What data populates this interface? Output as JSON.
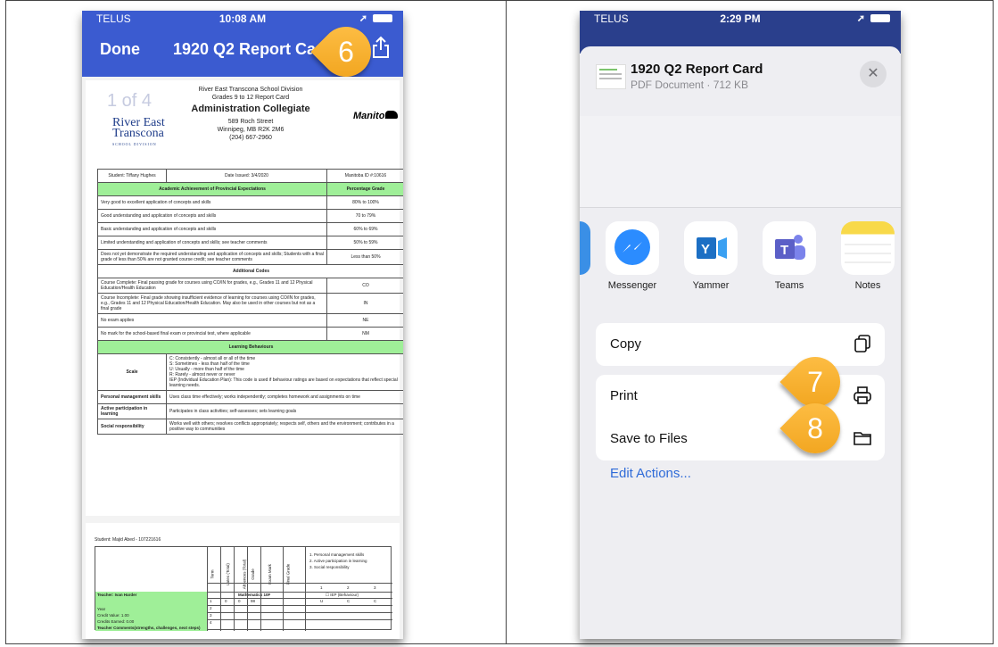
{
  "left_phone": {
    "status": {
      "carrier": "TELUS",
      "time": "10:08 AM"
    },
    "nav": {
      "done_label": "Done",
      "title": "1920 Q2 Report Card."
    },
    "step_badge": "6",
    "doc": {
      "page_count": "1 of 4",
      "header_lines": [
        "River East Transcona School Division",
        "Grades 9 to 12 Report Card"
      ],
      "school_name": "Administration Collegiate",
      "address_lines": [
        "589 Roch Street",
        "Winnipeg, MB R2K 2M6",
        "(204) 667-2960"
      ],
      "logo_left": [
        "River East",
        "Transcona"
      ],
      "logo_left_sub": "SCHOOL DIVISION",
      "logo_right": "Manitoba",
      "student_row": [
        "Student: Tiffany Hughes",
        "Date Issued: 3/4/2020",
        "Manitoba ID #:10616"
      ],
      "achievement_header": [
        "Academic Achievement of Provincial Expectations",
        "Percentage Grade"
      ],
      "achievement_rows": [
        [
          "Very good to excellent application of concepts and skills",
          "80% to 100%"
        ],
        [
          "Good understanding and application of concepts and skills",
          "70 to 79%"
        ],
        [
          "Basic understanding and application of concepts and skills",
          "60% to 69%"
        ],
        [
          "Limited understanding and application of concepts and skills; see teacher comments",
          "50% to 59%"
        ],
        [
          "Does not yet demonstrate the required understanding and application of concepts and skills; Students with a final grade of less than 50% are not granted course credit; see teacher comments",
          "Less than 50%"
        ]
      ],
      "additional_codes_title": "Additional Codes",
      "code_rows": [
        [
          "Course Complete: Final passing grade for courses using CO/IN for grades, e.g., Grades 11 and 12 Physical Education/Health Education",
          "CO"
        ],
        [
          "Course Incomplete: Final grade showing insufficient evidence of learning for courses using CO/IN for grades, e.g., Grades 11 and 12 Physical Education/Health Education. May also be used in other courses but not as a final grade",
          "IN"
        ],
        [
          "No exam applies",
          "NE"
        ],
        [
          "No mark for the school-based final exam or provincial test, where applicable",
          "NM"
        ]
      ],
      "learning_behaviours_title": "Learning Behaviours",
      "scale_label": "Scale",
      "scale_c": "C: Consistently - almost all or all of the time",
      "scale_s": "S: Sometimes - less than half of the time",
      "scale_u": "U: Usually - more than half of the time",
      "scale_r": "R: Rarely - almost never or never",
      "scale_iep": "IEP (Individual Education Plan): This code is used if behaviour ratings are based on expectations that reflect special learning needs.",
      "behaviour_rows": [
        [
          "Personal management skills",
          "Uses class time effectively; works independently; completes homework and assignments on time"
        ],
        [
          "Active participation in learning",
          "Participates in class activities; self-assesses; sets learning goals"
        ],
        [
          "Social responsibility",
          "Works well with others; resolves conflicts appropriately; respects self, others and the environment; contributes in a positive way to communities"
        ]
      ],
      "page2": {
        "student": "Student: Majid Abed - 107221616",
        "teacher": "Teacher: Ivan Harder",
        "course": "Mathematics 10F",
        "year": "Year",
        "credit_value": "Credit Value: 1.00",
        "credits_earned": "Credits Earned: 0.00",
        "comments": "Teacher Comments(strengths, challenges, next steps)",
        "legend": [
          "1. Personal management skills",
          "2. Active participation in learning",
          "3. Social responsibility"
        ],
        "col_heads": [
          "Term",
          "Lates (Total)",
          "Absences (Total)",
          "Grade",
          "Exam Mark",
          "Final Grade"
        ],
        "iep": "☐ IEP (Behaviour)",
        "row1": [
          "1",
          "0",
          "0",
          "98"
        ],
        "terms": [
          "2",
          "3",
          "4"
        ],
        "behav_marks": [
          "U",
          "C",
          "C"
        ],
        "behav_nums": [
          "1",
          "2",
          "3"
        ]
      }
    }
  },
  "right_phone": {
    "status": {
      "carrier": "TELUS",
      "time": "2:29 PM"
    },
    "file": {
      "name": "1920 Q2 Report Card",
      "meta": "PDF Document · 712 KB"
    },
    "apps": [
      {
        "label": "Messenger",
        "icon": "messenger-icon",
        "color": "#2b8cff"
      },
      {
        "label": "Yammer",
        "icon": "yammer-icon",
        "color": "#1c6fc4"
      },
      {
        "label": "Teams",
        "icon": "teams-icon",
        "color": "#5b5fc7"
      },
      {
        "label": "Notes",
        "icon": "notes-icon",
        "color": "#f8d94a"
      }
    ],
    "actions": {
      "copy": "Copy",
      "print": "Print",
      "save": "Save to Files",
      "edit": "Edit Actions..."
    },
    "badges": [
      "7",
      "8"
    ]
  },
  "colors": {
    "nav_blue": "#3b5bd0",
    "badge_orange": "#f5a623",
    "report_green": "#9fef98"
  }
}
